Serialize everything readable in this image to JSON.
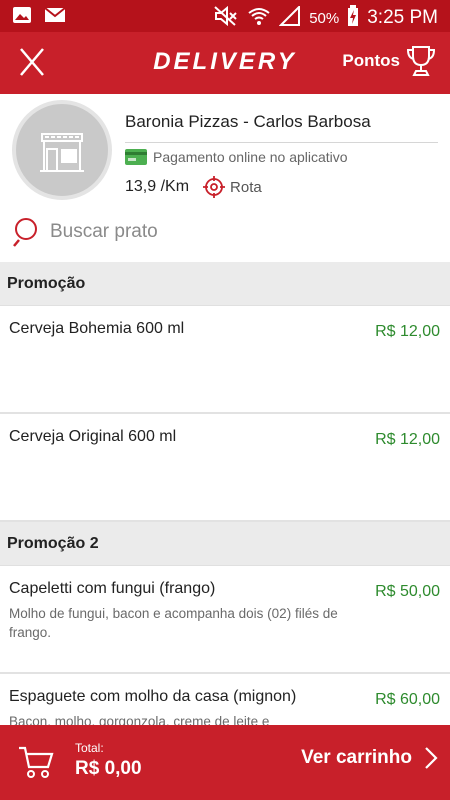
{
  "status_bar": {
    "battery": "50%",
    "time": "3:25 PM",
    "icons": [
      "gallery-icon",
      "mail-icon",
      "mute-icon",
      "wifi-icon",
      "signal-icon",
      "battery-charging-icon"
    ]
  },
  "app_bar": {
    "title": "DELIVERY",
    "points_label": "Pontos",
    "icons": [
      "close-icon",
      "trophy-icon"
    ]
  },
  "restaurant": {
    "name": "Baronia Pizzas - Carlos Barbosa",
    "payment": "Pagamento online no aplicativo",
    "distance": "13,9 /Km",
    "route_label": "Rota"
  },
  "search": {
    "placeholder": "Buscar prato"
  },
  "sections": [
    {
      "title": "Promoção",
      "items": [
        {
          "name": "Cerveja Bohemia 600 ml",
          "price": "R$ 12,00",
          "desc": ""
        },
        {
          "name": "Cerveja Original 600 ml",
          "price": "R$ 12,00",
          "desc": ""
        }
      ]
    },
    {
      "title": "Promoção 2",
      "items": [
        {
          "name": "Capeletti com fungui (frango)",
          "price": "R$ 50,00",
          "desc": "Molho de fungui, bacon e acompanha dois (02) filés de frango."
        },
        {
          "name": "Espaguete com molho da casa (mignon)",
          "price": "R$ 60,00",
          "desc": "Bacon, molho, gorgonzola, creme de leite e"
        }
      ]
    }
  ],
  "cart": {
    "total_label": "Total:",
    "total_value": "R$ 0,00",
    "button_label": "Ver carrinho"
  },
  "colors": {
    "primary_red": "#c8202a",
    "status_red": "#b5121b",
    "price_green": "#2e8b2e",
    "section_grey": "#ebebeb"
  }
}
